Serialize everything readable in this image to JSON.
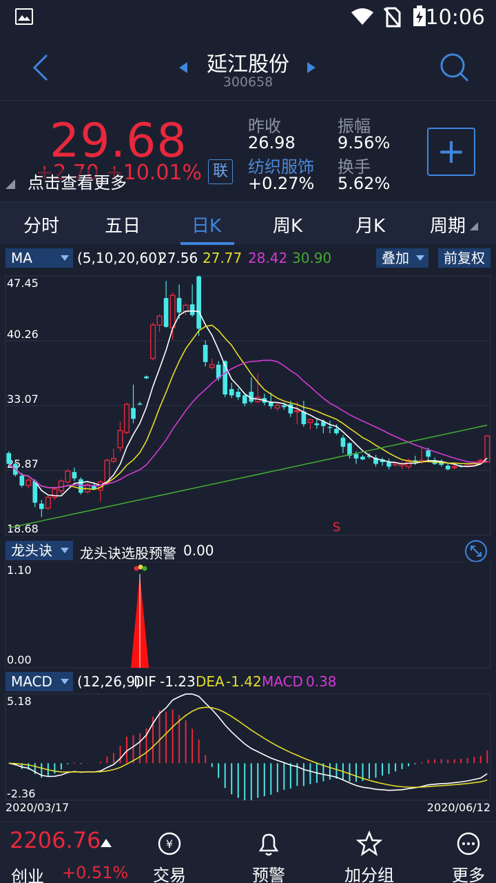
{
  "status_bar": {
    "time": "10:06"
  },
  "header": {
    "name": "延江股份",
    "code": "300658"
  },
  "quote": {
    "price": "29.68",
    "change": "+2.70  +10.01%",
    "hint": "点击查看更多",
    "lian_label": "联",
    "prev_close_label": "昨收",
    "prev_close": "26.98",
    "industry_label": "纺织服饰",
    "industry_change": "+0.27%",
    "amplitude_label": "振幅",
    "amplitude": "9.56%",
    "turnover_label": "换手",
    "turnover": "5.62%",
    "add_label": "+"
  },
  "tabs": [
    "分时",
    "五日",
    "日K",
    "周K",
    "月K",
    "周期"
  ],
  "ma_bar": {
    "dropdown": "MA",
    "params": "(5,10,20,60)",
    "v5": "27.56",
    "v10": "27.77",
    "v20": "28.42",
    "v60": "30.90",
    "overlay_label": "叠加",
    "adjust_label": "前复权"
  },
  "colors": {
    "up": "#e8283c",
    "down": "#49e8e8",
    "ma5": "#ffffff",
    "ma10": "#e6dd2a",
    "ma20": "#d43bd4",
    "ma60": "#44a832",
    "accent": "#3f86dd"
  },
  "chart_data": [
    {
      "type": "candlestick",
      "title": "",
      "y_ticks": [
        "47.45",
        "40.26",
        "33.07",
        "25.87",
        "18.68"
      ],
      "ylim": [
        18.68,
        47.45
      ],
      "marker": "S",
      "candles": [
        [
          27.8,
          26.6,
          28.0,
          26.4
        ],
        [
          26.6,
          25.4,
          26.9,
          25.2
        ],
        [
          25.3,
          24.2,
          25.6,
          24.0
        ],
        [
          24.2,
          24.8,
          25.0,
          23.9
        ],
        [
          24.7,
          22.3,
          24.9,
          21.8
        ],
        [
          22.2,
          21.6,
          22.6,
          20.7
        ],
        [
          21.7,
          22.9,
          23.1,
          21.5
        ],
        [
          22.9,
          23.8,
          24.0,
          22.6
        ],
        [
          23.6,
          24.7,
          24.9,
          23.2
        ],
        [
          24.6,
          25.8,
          26.0,
          24.4
        ],
        [
          25.7,
          25.0,
          26.2,
          24.7
        ],
        [
          24.9,
          23.4,
          25.1,
          23.2
        ],
        [
          23.5,
          24.3,
          24.5,
          23.3
        ],
        [
          24.2,
          23.8,
          24.6,
          23.7
        ],
        [
          23.7,
          24.6,
          24.8,
          22.4
        ],
        [
          24.5,
          27.0,
          27.2,
          24.2
        ],
        [
          26.9,
          27.2,
          28.3,
          26.7
        ],
        [
          28.4,
          30.3,
          31.3,
          28.0
        ],
        [
          30.1,
          33.2,
          33.4,
          29.9
        ],
        [
          32.8,
          31.6,
          35.4,
          31.1
        ],
        [
          33.3,
          33.2,
          33.5,
          33.1
        ],
        [
          36.3,
          36.1,
          36.4,
          36.0
        ],
        [
          38.3,
          42.0,
          42.3,
          38.1
        ],
        [
          42.0,
          43.0,
          43.2,
          41.2
        ],
        [
          45.0,
          41.8,
          46.9,
          41.7
        ],
        [
          41.7,
          45.3,
          45.6,
          40.4
        ],
        [
          45.0,
          43.4,
          46.5,
          42.7
        ],
        [
          43.5,
          44.2,
          44.4,
          43.1
        ],
        [
          44.3,
          43.1,
          46.5,
          42.9
        ],
        [
          47.4,
          41.6,
          47.5,
          40.8
        ],
        [
          39.8,
          37.9,
          40.3,
          37.4
        ],
        [
          37.3,
          37.6,
          38.3,
          37.1
        ],
        [
          37.6,
          36.1,
          38.0,
          35.8
        ],
        [
          38.0,
          34.3,
          38.1,
          34.0
        ],
        [
          34.9,
          34.2,
          35.6,
          33.9
        ],
        [
          34.6,
          34.0,
          35.0,
          33.7
        ],
        [
          34.2,
          33.3,
          34.4,
          33.0
        ],
        [
          34.6,
          33.5,
          36.2,
          33.3
        ],
        [
          33.5,
          34.0,
          36.6,
          33.3
        ],
        [
          33.9,
          33.4,
          34.4,
          33.1
        ],
        [
          33.5,
          33.0,
          34.5,
          32.7
        ],
        [
          32.8,
          33.1,
          33.3,
          32.5
        ],
        [
          33.1,
          32.9,
          33.3,
          32.6
        ],
        [
          33.2,
          32.2,
          33.6,
          31.8
        ],
        [
          32.4,
          32.5,
          33.5,
          31.0
        ],
        [
          32.4,
          31.0,
          33.6,
          30.7
        ],
        [
          31.2,
          31.5,
          31.6,
          30.4
        ],
        [
          31.1,
          30.9,
          31.7,
          30.5
        ],
        [
          31.3,
          30.8,
          31.5,
          30.0
        ],
        [
          30.7,
          30.6,
          31.4,
          30.0
        ],
        [
          30.5,
          30.0,
          31.0,
          29.8
        ],
        [
          29.5,
          28.5,
          29.8,
          27.8
        ],
        [
          28.9,
          27.5,
          29.0,
          27.2
        ],
        [
          27.7,
          27.2,
          28.0,
          26.6
        ],
        [
          27.4,
          27.1,
          27.6,
          27.0
        ],
        [
          27.5,
          27.4,
          27.8,
          27.2
        ],
        [
          27.3,
          26.6,
          27.6,
          26.3
        ],
        [
          27.1,
          26.8,
          27.3,
          26.4
        ],
        [
          26.8,
          26.3,
          27.2,
          26.0
        ],
        [
          26.5,
          26.7,
          26.8,
          26.3
        ],
        [
          26.4,
          26.6,
          26.9,
          26.0
        ],
        [
          26.3,
          27.0,
          27.2,
          26.0
        ],
        [
          27.0,
          26.8,
          27.5,
          26.5
        ],
        [
          26.8,
          27.0,
          28.4,
          26.6
        ],
        [
          28.1,
          27.4,
          28.4,
          27.0
        ],
        [
          27.0,
          26.6,
          27.3,
          26.5
        ],
        [
          26.9,
          26.5,
          27.1,
          26.3
        ],
        [
          26.4,
          26.0,
          26.6,
          25.9
        ],
        [
          26.2,
          26.3,
          26.6,
          26.0
        ],
        [
          26.4,
          26.3,
          26.5,
          26.2
        ],
        [
          26.3,
          26.5,
          26.6,
          26.2
        ],
        [
          26.4,
          26.8,
          26.9,
          26.3
        ],
        [
          26.9,
          27.0,
          27.2,
          26.8
        ],
        [
          26.8,
          29.7,
          29.8,
          26.8
        ]
      ]
    },
    {
      "type": "area",
      "title": "",
      "dropdown": "龙头诀",
      "label": "龙头诀选股预警",
      "value": "0.00",
      "y_ticks": [
        "1.10",
        "0.00"
      ],
      "ylim": [
        0,
        1.1
      ],
      "spike_index": 20
    },
    {
      "type": "bar",
      "title": "",
      "dropdown": "MACD",
      "params": "(12,26,9)",
      "dif_label": "DIF",
      "dif": "-1.23",
      "dea_label": "DEA",
      "dea": "-1.42",
      "macd_label": "MACD",
      "macd": "0.38",
      "y_ticks": [
        "5.18",
        "-2.36"
      ],
      "ylim": [
        -2.36,
        5.18
      ],
      "x_start": "2020/03/17",
      "x_end": "2020/06/12"
    }
  ],
  "bottom_bar": {
    "index_value": "2206.76",
    "index_name": "创业",
    "index_change": "+0.51%",
    "items": [
      {
        "label": "交易",
        "icon": "exchange-icon"
      },
      {
        "label": "预警",
        "icon": "bell-icon"
      },
      {
        "label": "加分组",
        "icon": "star-icon"
      },
      {
        "label": "更多",
        "icon": "more-icon"
      }
    ]
  }
}
